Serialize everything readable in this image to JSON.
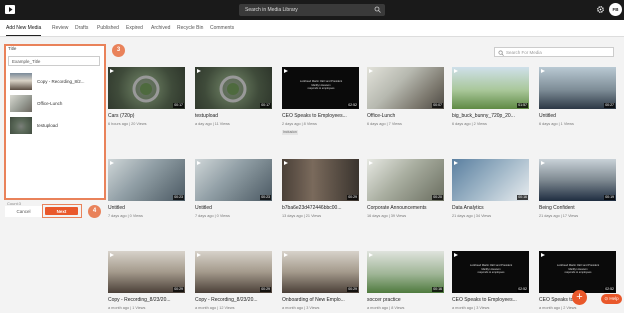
{
  "topbar": {
    "search_placeholder": "Search in Media Library",
    "avatar_initials": "FB"
  },
  "tabs": [
    {
      "label": "Add New Media"
    },
    {
      "label": "Review"
    },
    {
      "label": "Drafts"
    },
    {
      "label": "Published"
    },
    {
      "label": "Expired"
    },
    {
      "label": "Archived"
    },
    {
      "label": "Recycle Bin"
    },
    {
      "label": "Comments"
    }
  ],
  "panel": {
    "title_label": "Title",
    "title_value": "Example_Title",
    "items": [
      {
        "label": "Copy - Recording_8/2..."
      },
      {
        "label": "Office-Lunch"
      },
      {
        "label": "testupload"
      }
    ],
    "count_text": "Count:3",
    "cancel_label": "Cancel",
    "next_label": "Next"
  },
  "steps": {
    "one": "3",
    "two": "4"
  },
  "search_media_placeholder": "Search For Media",
  "cards": [
    {
      "title": "Cars (720p)",
      "meta": "6 hours ago  |  20 Views",
      "duration": "00:17"
    },
    {
      "title": "testupload",
      "meta": "a day ago  |  11 Views",
      "duration": "00:17"
    },
    {
      "title": "CEO Speaks to Employees...",
      "meta": "2 days ago  |  8 Views",
      "duration": "02:52",
      "tag": "Inclusion",
      "slide": "Lockheed Martin CEO and President Marillyn Hewson\nresponds to employees"
    },
    {
      "title": "Office-Lunch",
      "meta": "6 days ago  |  7 Views",
      "duration": "00:07"
    },
    {
      "title": "big_buck_bunny_720p_20...",
      "meta": "6 days ago  |  2 Views",
      "duration": "01:57"
    },
    {
      "title": "Untitled",
      "meta": "6 days ago  |  1 Views",
      "duration": "00:27"
    },
    {
      "title": "Untitled",
      "meta": "7 days ago  |  0 Views",
      "duration": "00:23"
    },
    {
      "title": "Untitled",
      "meta": "7 days ago  |  0 Views",
      "duration": "00:23"
    },
    {
      "title": "b7ba6e23d472446bbc00...",
      "meta": "13 days ago  |  21 Views",
      "duration": "00:29"
    },
    {
      "title": "Corporate Announcements",
      "meta": "16 days ago  |  39 Views",
      "duration": "00:20"
    },
    {
      "title": "Data Analytics",
      "meta": "21 days ago  |  34 Views",
      "duration": "00:16"
    },
    {
      "title": "Being Confident",
      "meta": "21 days ago  |  17 Views",
      "duration": "00:19"
    },
    {
      "title": "Copy - Recording_8/23/20...",
      "meta": "a month ago  |  1 Views",
      "duration": "00:29"
    },
    {
      "title": "Copy - Recording_8/23/20...",
      "meta": "a month ago  |  12 Views",
      "duration": "00:29"
    },
    {
      "title": "Onboarding of New Emplo...",
      "meta": "a month ago  |  3 Views",
      "duration": "00:29"
    },
    {
      "title": "soccer practice",
      "meta": "a month ago  |  8 Views",
      "duration": "00:16"
    },
    {
      "title": "CEO Speaks to Employees...",
      "meta": "a month ago  |  3 Views",
      "duration": "02:52",
      "slide": "Lockheed Martin CEO and President Marillyn Hewson\nresponds to employees"
    },
    {
      "title": "CEO Speaks to Em...",
      "meta": "a month ago  |  2 Views",
      "duration": "02:52",
      "slide": "Lockheed Martin CEO and President Marillyn Hewson\nresponds to employees"
    }
  ]
}
